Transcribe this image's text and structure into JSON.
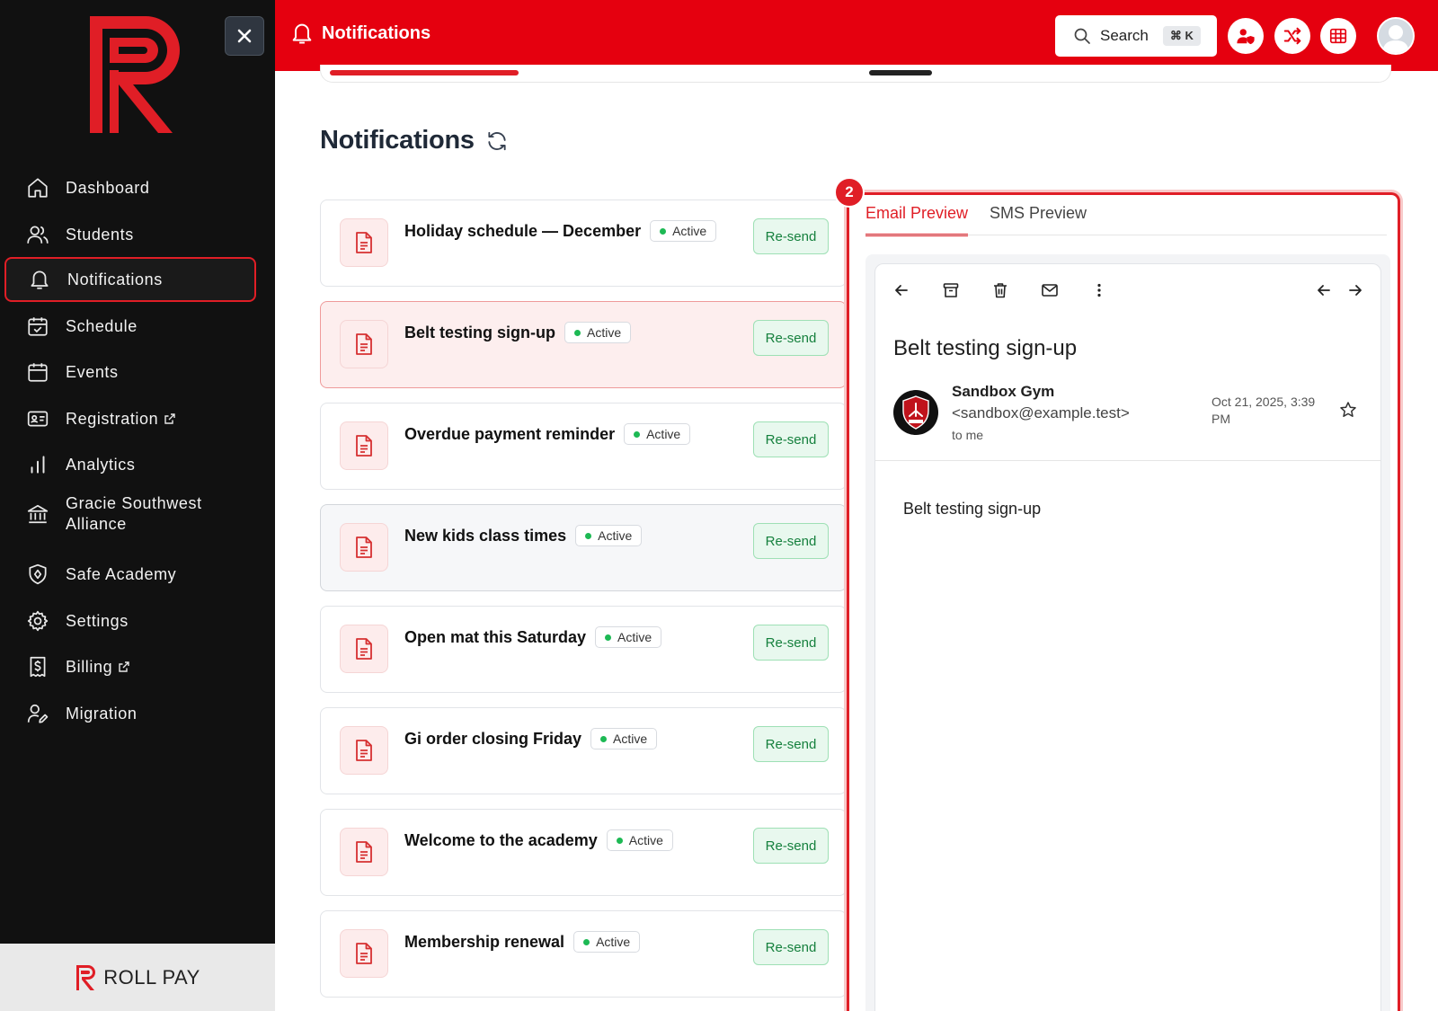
{
  "app": {
    "brand_footer": "ROLL PAY"
  },
  "header": {
    "title": "Notifications",
    "search_label": "Search",
    "search_shortcut": "⌘ K"
  },
  "sidebar": {
    "items": [
      {
        "label": "Dashboard",
        "icon": "home-icon"
      },
      {
        "label": "Students",
        "icon": "users-icon"
      },
      {
        "label": "Notifications",
        "icon": "bell-icon",
        "active": true
      },
      {
        "label": "Schedule",
        "icon": "calendar-check-icon"
      },
      {
        "label": "Events",
        "icon": "calendar-icon"
      },
      {
        "label": "Registration",
        "icon": "id-card-icon",
        "external": true
      },
      {
        "label": "Analytics",
        "icon": "bar-chart-icon"
      },
      {
        "label": "Gracie Southwest Alliance",
        "icon": "bank-icon"
      },
      {
        "label": "Safe Academy",
        "icon": "shield-icon"
      },
      {
        "label": "Settings",
        "icon": "gear-icon"
      },
      {
        "label": "Billing",
        "icon": "billing-icon",
        "external": true
      },
      {
        "label": "Migration",
        "icon": "user-edit-icon"
      }
    ]
  },
  "main": {
    "page_title": "Notifications",
    "resend_label": "Re-send",
    "status_label": "Active",
    "notifications": [
      {
        "title": "Holiday schedule — December",
        "status": "Active"
      },
      {
        "title": "Belt testing sign-up",
        "status": "Active",
        "selected": true
      },
      {
        "title": "Overdue payment reminder",
        "status": "Active"
      },
      {
        "title": "New kids class times",
        "status": "Active"
      },
      {
        "title": "Open mat this Saturday",
        "status": "Active"
      },
      {
        "title": "Gi order closing Friday",
        "status": "Active"
      },
      {
        "title": "Welcome to the academy",
        "status": "Active"
      },
      {
        "title": "Membership renewal",
        "status": "Active"
      }
    ]
  },
  "preview": {
    "step_number": "2",
    "tabs": [
      "Email Preview",
      "SMS Preview"
    ],
    "active_tab": "Email Preview",
    "email": {
      "subject": "Belt testing sign-up",
      "sender_name": "Sandbox Gym",
      "sender_email": "<sandbox@example.test>",
      "to": "to me",
      "date": "Oct 21, 2025, 3:39 PM",
      "body": "Belt testing sign-up"
    }
  },
  "colors": {
    "brand_red": "#e5000f",
    "sidebar_bg": "#111111",
    "resend_green": "#15803d",
    "active_dot": "#1db954"
  }
}
